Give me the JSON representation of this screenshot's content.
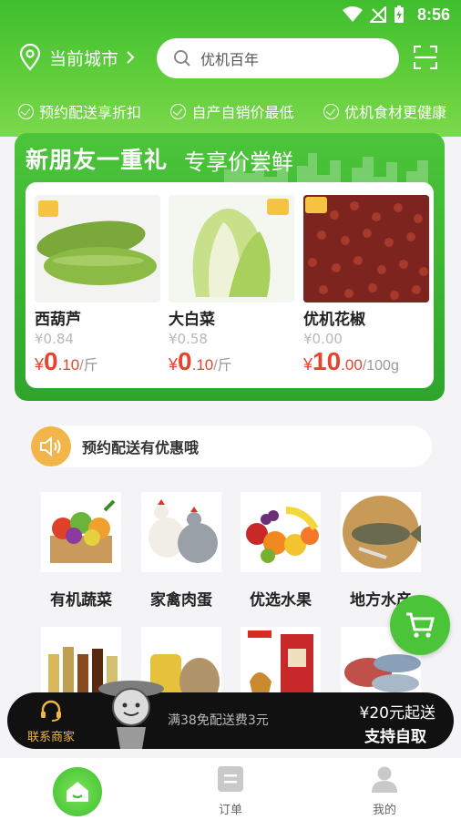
{
  "status": {
    "time": "8:56"
  },
  "header": {
    "city_label": "当前城市",
    "search_placeholder": "优机百年",
    "features": [
      "预约配送享折扣",
      "自产自销价最低",
      "优机食材更健康"
    ]
  },
  "promo": {
    "title": "新朋友一重礼",
    "subtitle": "专享价尝鲜",
    "products": [
      {
        "name": "西葫芦",
        "old_price": "¥0.84",
        "symbol": "¥",
        "int": "0",
        "dec": ".10",
        "unit": "/斤"
      },
      {
        "name": "大白菜",
        "old_price": "¥0.58",
        "symbol": "¥",
        "int": "0",
        "dec": ".10",
        "unit": "/斤"
      },
      {
        "name": "优机花椒",
        "old_price": "¥0.00",
        "symbol": "¥",
        "int": "10",
        "dec": ".00",
        "unit": "/100g"
      }
    ]
  },
  "notice": {
    "text": "预约配送有优惠哦"
  },
  "categories": [
    {
      "label": "有机蔬菜"
    },
    {
      "label": "家禽肉蛋"
    },
    {
      "label": "优选水果"
    },
    {
      "label": "地方水产"
    }
  ],
  "bottom_bar": {
    "contact_label": "联系商家",
    "shipping_text": "满38免配送费3元",
    "min_order": "¥20元起送",
    "pickup": "支持自取"
  },
  "tabs": [
    {
      "label": ""
    },
    {
      "label": "订单"
    },
    {
      "label": "我的"
    }
  ],
  "colors": {
    "brand_green": "#4cc43a",
    "price_red": "#e8432e",
    "accent_orange": "#f2b54a"
  }
}
